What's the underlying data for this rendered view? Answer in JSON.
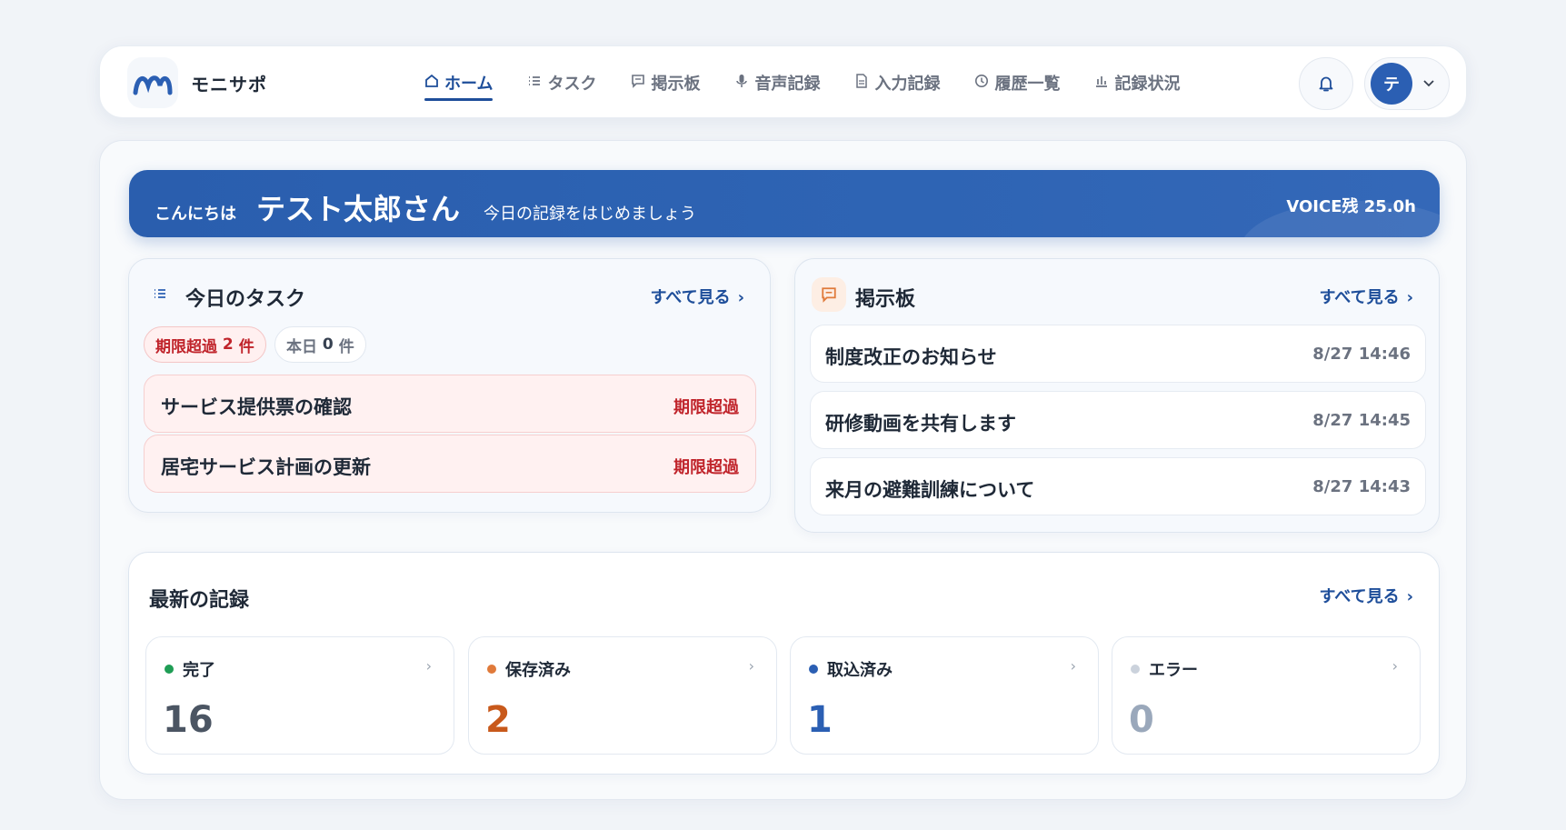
{
  "app": {
    "name": "モニサポ"
  },
  "nav": {
    "items": [
      {
        "label": "ホーム",
        "icon": "home-icon",
        "active": true
      },
      {
        "label": "タスク",
        "icon": "list-icon",
        "active": false
      },
      {
        "label": "掲示板",
        "icon": "message-icon",
        "active": false
      },
      {
        "label": "音声記録",
        "icon": "mic-icon",
        "active": false
      },
      {
        "label": "入力記録",
        "icon": "document-icon",
        "active": false
      },
      {
        "label": "履歴一覧",
        "icon": "clock-icon",
        "active": false
      },
      {
        "label": "記録状況",
        "icon": "chart-icon",
        "active": false
      }
    ]
  },
  "user": {
    "initial": "テ"
  },
  "banner": {
    "greeting": "こんにちは",
    "name": "テスト太郎さん",
    "subtitle": "今日の記録をはじめましょう",
    "voice": "VOICE残 25.0h"
  },
  "tasks": {
    "title": "今日のタスク",
    "see_all": "すべて見る",
    "overdue_label": "期限超過",
    "overdue_count": "2",
    "count_unit": "件",
    "today_label": "本日",
    "today_count": "0",
    "items": [
      {
        "title": "サービス提供票の確認",
        "status": "期限超過"
      },
      {
        "title": "居宅サービス計画の更新",
        "status": "期限超過"
      }
    ]
  },
  "board": {
    "title": "掲示板",
    "see_all": "すべて見る",
    "posts": [
      {
        "title": "制度改正のお知らせ",
        "date": "8/27 14:46"
      },
      {
        "title": "研修動画を共有します",
        "date": "8/27 14:45"
      },
      {
        "title": "来月の避難訓練について",
        "date": "8/27 14:43"
      }
    ]
  },
  "records": {
    "title": "最新の記録",
    "see_all": "すべて見る",
    "stats": [
      {
        "label": "完了",
        "value": "16",
        "dot_color": "#1f9d55",
        "value_color": "#4b5563"
      },
      {
        "label": "保存済み",
        "value": "2",
        "dot_color": "#e07a3a",
        "value_color": "#c8591b"
      },
      {
        "label": "取込済み",
        "value": "1",
        "dot_color": "#2b5fb3",
        "value_color": "#2b5fb3"
      },
      {
        "label": "エラー",
        "value": "0",
        "dot_color": "#cbd2dc",
        "value_color": "#9aa8bb"
      }
    ]
  },
  "colors": {
    "accent": "#1e4e9a",
    "banner": "#2e64b4",
    "danger": "#c0242b"
  }
}
